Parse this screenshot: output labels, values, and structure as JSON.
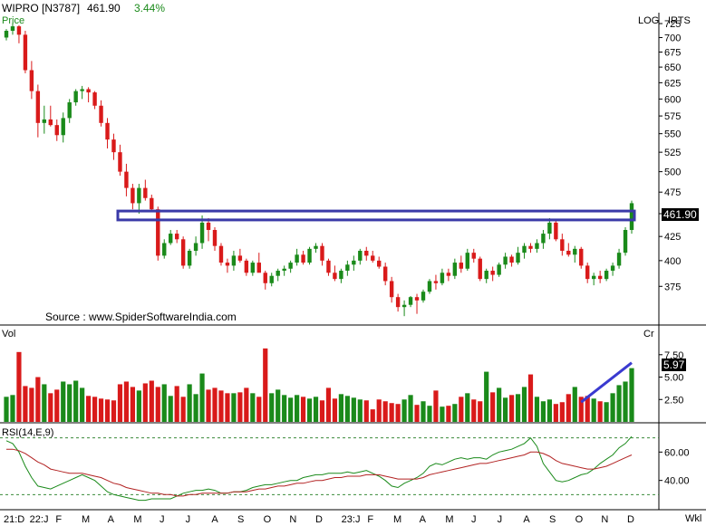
{
  "header": {
    "symbol": "WIPRO [N3787]",
    "last_price": "461.90",
    "change_pct": "3.44%",
    "price_panel_label": "Price",
    "scale_mode": "LOG",
    "scale_type": "IRTS",
    "source": "Source : www.SpiderSoftwareIndia.com",
    "volume_label": "Vol",
    "volume_unit": "Cr",
    "rsi_label": "RSI(14,E,9)",
    "last_volume_tag": "5.97",
    "last_price_tag": "461.90",
    "period": "Wkl"
  },
  "colors": {
    "up": "#1a8a1a",
    "down": "#d91a1a",
    "breakout_box": "#3a3aa8",
    "trend_line": "#3a3ad0",
    "rsi": "#1a8a1a",
    "rsi_signal": "#b22222",
    "gridline": "#3a8a3a"
  },
  "chart_data": [
    {
      "type": "candlestick",
      "panel": "price",
      "scale": "log",
      "ylim": [
        345,
        735
      ],
      "y_ticks": [
        375,
        400,
        425,
        450,
        475,
        500,
        525,
        550,
        575,
        600,
        625,
        650,
        675,
        700,
        725
      ],
      "x_ticks": [
        "21:D",
        "22:J",
        "F",
        "M",
        "A",
        "M",
        "J",
        "J",
        "A",
        "S",
        "O",
        "N",
        "D",
        "23:J",
        "F",
        "M",
        "A",
        "M",
        "J",
        "J",
        "A",
        "S",
        "O",
        "N",
        "D"
      ],
      "candles": [
        [
          700,
          715,
          695,
          712
        ],
        [
          712,
          726,
          705,
          720
        ],
        [
          720,
          722,
          690,
          705
        ],
        [
          705,
          712,
          640,
          645
        ],
        [
          645,
          660,
          600,
          612
        ],
        [
          612,
          622,
          545,
          565
        ],
        [
          565,
          590,
          550,
          570
        ],
        [
          570,
          590,
          560,
          562
        ],
        [
          562,
          570,
          540,
          548
        ],
        [
          548,
          580,
          538,
          572
        ],
        [
          572,
          600,
          565,
          595
        ],
        [
          595,
          615,
          590,
          612
        ],
        [
          612,
          620,
          600,
          615
        ],
        [
          615,
          618,
          595,
          610
        ],
        [
          610,
          612,
          585,
          590
        ],
        [
          590,
          598,
          560,
          565
        ],
        [
          565,
          572,
          530,
          542
        ],
        [
          542,
          550,
          515,
          525
        ],
        [
          525,
          535,
          495,
          500
        ],
        [
          500,
          510,
          470,
          480
        ],
        [
          480,
          485,
          455,
          462
        ],
        [
          462,
          485,
          450,
          480
        ],
        [
          480,
          490,
          465,
          468
        ],
        [
          468,
          472,
          452,
          455
        ],
        [
          455,
          458,
          400,
          405
        ],
        [
          405,
          422,
          402,
          418
        ],
        [
          418,
          432,
          416,
          428
        ],
        [
          428,
          432,
          418,
          422
        ],
        [
          422,
          425,
          392,
          395
        ],
        [
          395,
          412,
          392,
          410
        ],
        [
          410,
          425,
          405,
          418
        ],
        [
          418,
          448,
          412,
          440
        ],
        [
          440,
          445,
          420,
          432
        ],
        [
          432,
          435,
          410,
          415
        ],
        [
          415,
          418,
          395,
          398
        ],
        [
          398,
          402,
          388,
          395
        ],
        [
          395,
          410,
          390,
          405
        ],
        [
          405,
          412,
          398,
          400
        ],
        [
          400,
          402,
          385,
          388
        ],
        [
          388,
          400,
          385,
          398
        ],
        [
          398,
          408,
          395,
          388
        ],
        [
          388,
          390,
          372,
          378
        ],
        [
          378,
          388,
          375,
          385
        ],
        [
          385,
          392,
          380,
          390
        ],
        [
          390,
          395,
          385,
          392
        ],
        [
          392,
          400,
          388,
          398
        ],
        [
          398,
          412,
          395,
          406
        ],
        [
          406,
          410,
          396,
          398
        ],
        [
          398,
          414,
          396,
          412
        ],
        [
          412,
          418,
          408,
          415
        ],
        [
          415,
          418,
          395,
          400
        ],
        [
          400,
          402,
          385,
          388
        ],
        [
          388,
          395,
          380,
          382
        ],
        [
          382,
          392,
          378,
          390
        ],
        [
          390,
          400,
          385,
          396
        ],
        [
          396,
          405,
          390,
          400
        ],
        [
          400,
          412,
          396,
          410
        ],
        [
          410,
          414,
          400,
          405
        ],
        [
          405,
          410,
          398,
          400
        ],
        [
          400,
          404,
          392,
          394
        ],
        [
          394,
          398,
          376,
          380
        ],
        [
          380,
          384,
          360,
          365
        ],
        [
          365,
          368,
          352,
          356
        ],
        [
          356,
          362,
          348,
          358
        ],
        [
          358,
          366,
          356,
          365
        ],
        [
          365,
          368,
          350,
          362
        ],
        [
          362,
          372,
          360,
          370
        ],
        [
          370,
          382,
          368,
          380
        ],
        [
          380,
          386,
          372,
          378
        ],
        [
          378,
          392,
          376,
          388
        ],
        [
          388,
          392,
          380,
          385
        ],
        [
          385,
          402,
          382,
          398
        ],
        [
          398,
          405,
          388,
          392
        ],
        [
          392,
          412,
          390,
          408
        ],
        [
          408,
          412,
          398,
          402
        ],
        [
          402,
          404,
          380,
          382
        ],
        [
          382,
          392,
          378,
          390
        ],
        [
          390,
          394,
          380,
          386
        ],
        [
          386,
          398,
          384,
          396
        ],
        [
          396,
          408,
          392,
          404
        ],
        [
          404,
          406,
          394,
          398
        ],
        [
          398,
          414,
          396,
          408
        ],
        [
          408,
          418,
          402,
          415
        ],
        [
          415,
          418,
          408,
          412
        ],
        [
          412,
          422,
          408,
          418
        ],
        [
          418,
          432,
          412,
          428
        ],
        [
          428,
          445,
          422,
          440
        ],
        [
          440,
          442,
          420,
          422
        ],
        [
          422,
          428,
          405,
          410
        ],
        [
          410,
          418,
          404,
          406
        ],
        [
          406,
          415,
          398,
          412
        ],
        [
          412,
          414,
          392,
          395
        ],
        [
          395,
          398,
          378,
          382
        ],
        [
          382,
          388,
          376,
          385
        ],
        [
          385,
          390,
          378,
          382
        ],
        [
          382,
          392,
          380,
          390
        ],
        [
          390,
          398,
          385,
          395
        ],
        [
          395,
          412,
          392,
          408
        ],
        [
          408,
          435,
          405,
          432
        ],
        [
          432,
          465,
          428,
          462
        ]
      ]
    },
    {
      "type": "bar",
      "panel": "volume",
      "unit": "Cr",
      "ylim": [
        0,
        9.5
      ],
      "y_ticks": [
        2.5,
        5.0,
        7.5
      ],
      "values": [
        2.8,
        3.0,
        7.8,
        4.0,
        3.8,
        5.0,
        4.2,
        3.2,
        3.6,
        4.5,
        4.2,
        4.6,
        3.8,
        2.9,
        2.8,
        2.6,
        2.5,
        2.4,
        4.2,
        4.5,
        3.9,
        3.5,
        4.3,
        4.6,
        3.9,
        4.2,
        2.9,
        4.0,
        2.8,
        4.2,
        3.1,
        5.4,
        3.6,
        3.8,
        3.5,
        3.2,
        3.2,
        3.3,
        3.8,
        3.2,
        2.8,
        8.2,
        3.2,
        3.6,
        3.0,
        2.7,
        3.0,
        2.8,
        2.6,
        2.8,
        2.4,
        3.8,
        2.6,
        3.1,
        2.9,
        2.7,
        2.5,
        2.4,
        1.4,
        2.5,
        2.3,
        2.1,
        2.0,
        2.5,
        3.0,
        1.9,
        2.3,
        1.8,
        3.5,
        1.7,
        1.8,
        2.0,
        2.8,
        3.2,
        2.5,
        2.3,
        5.6,
        3.3,
        3.8,
        2.7,
        3.0,
        3.1,
        3.9,
        5.3,
        2.8,
        2.3,
        2.5,
        2.0,
        2.2,
        3.1,
        3.9,
        2.8,
        2.9,
        2.6,
        2.3,
        2.2,
        3.2,
        4.1,
        4.5,
        6.0
      ]
    },
    {
      "type": "line",
      "panel": "rsi",
      "ylim": [
        20,
        80
      ],
      "y_ticks": [
        40,
        60
      ],
      "series": [
        {
          "values": [
            68,
            66,
            60,
            50,
            42,
            36,
            35,
            34,
            36,
            38,
            40,
            42,
            44,
            42,
            40,
            36,
            32,
            30,
            29,
            28,
            27,
            26,
            26,
            27,
            27,
            27,
            27,
            29,
            31,
            32,
            33,
            33,
            34,
            33,
            31,
            31,
            32,
            32,
            33,
            35,
            36,
            37,
            37,
            38,
            39,
            40,
            40,
            42,
            43,
            44,
            44,
            45,
            45,
            45,
            46,
            45,
            46,
            47,
            45,
            43,
            40,
            36,
            35,
            38,
            40,
            42,
            45,
            50,
            52,
            51,
            53,
            55,
            56,
            55,
            56,
            56,
            55,
            58,
            60,
            61,
            62,
            64,
            66,
            70,
            64,
            52,
            46,
            40,
            39,
            40,
            42,
            44,
            45,
            48,
            52,
            55,
            58,
            63,
            66,
            71
          ]
        },
        {
          "values": [
            62,
            62,
            61,
            59,
            56,
            53,
            51,
            48,
            47,
            46,
            45,
            45,
            45,
            44,
            43,
            42,
            40,
            38,
            37,
            35,
            34,
            33,
            32,
            31,
            31,
            30,
            30,
            29,
            29,
            30,
            30,
            31,
            31,
            31,
            31,
            31,
            32,
            32,
            32,
            33,
            34,
            34,
            35,
            36,
            36,
            37,
            38,
            38,
            39,
            40,
            40,
            41,
            42,
            42,
            43,
            43,
            43,
            44,
            44,
            44,
            43,
            42,
            41,
            41,
            41,
            41,
            42,
            44,
            45,
            46,
            47,
            48,
            49,
            50,
            51,
            52,
            52,
            53,
            54,
            55,
            56,
            57,
            58,
            60,
            60,
            59,
            57,
            54,
            52,
            51,
            50,
            49,
            48,
            48,
            49,
            50,
            52,
            54,
            56,
            58
          ]
        }
      ]
    }
  ]
}
